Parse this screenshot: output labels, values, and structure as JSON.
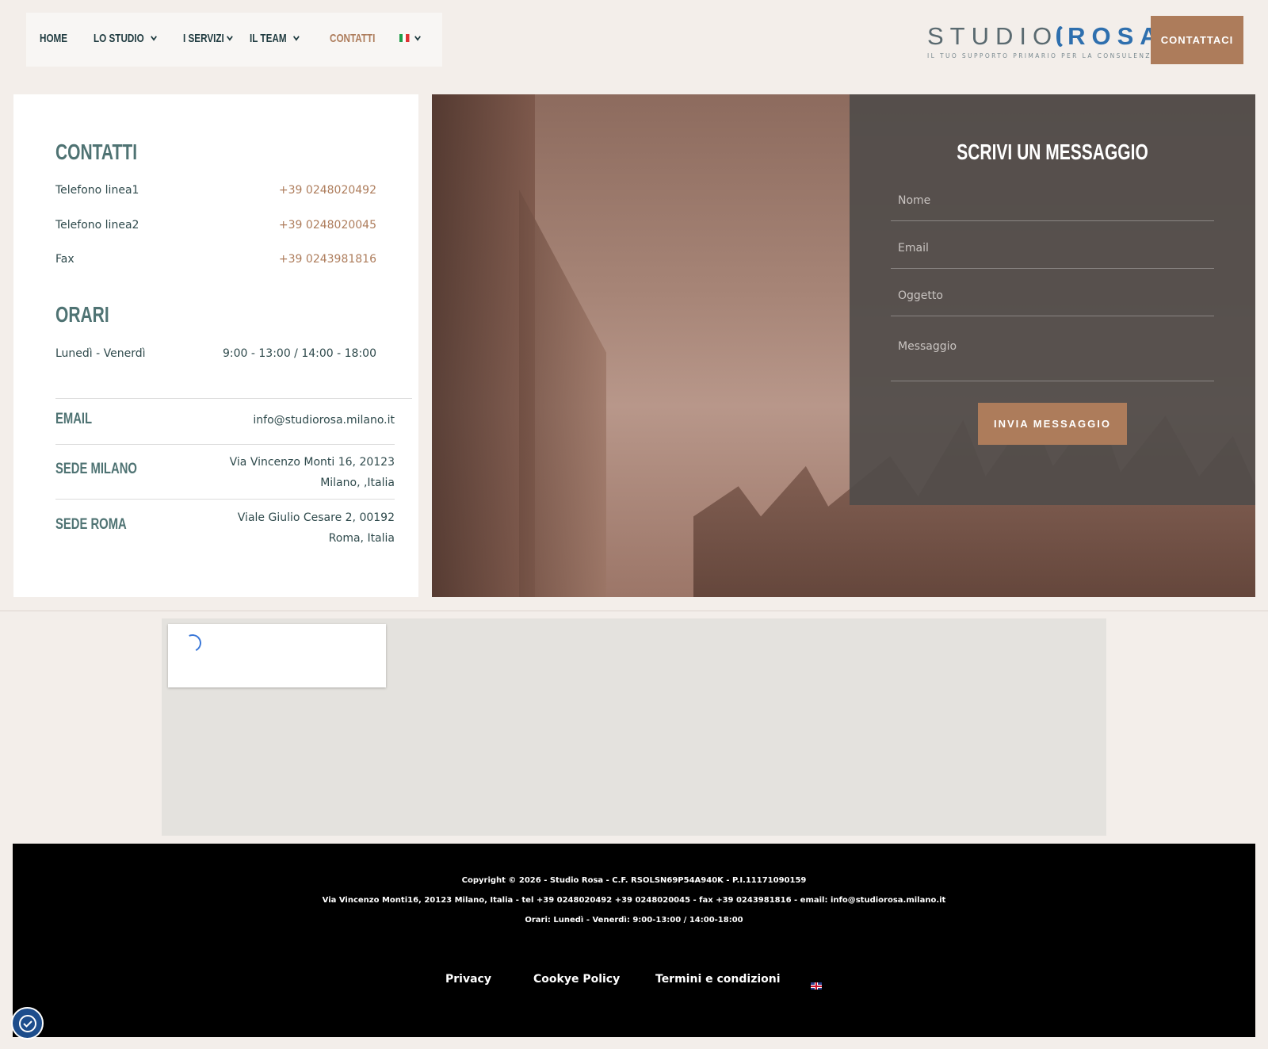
{
  "nav": {
    "items": [
      {
        "label": "HOME",
        "dropdown": false,
        "active": false
      },
      {
        "label": "LO STUDIO",
        "dropdown": true,
        "active": false
      },
      {
        "label": "I SERVIZI",
        "dropdown": true,
        "active": false
      },
      {
        "label": "IL TEAM",
        "dropdown": true,
        "active": false
      },
      {
        "label": "CONTATTI",
        "dropdown": false,
        "active": true
      }
    ],
    "language_flag": "flag-it-icon"
  },
  "logo": {
    "word1": "STUDIO",
    "word2": "ROSA",
    "tagline": "IL TUO SUPPORTO PRIMARIO PER LA CONSULENZA"
  },
  "header_button": "CONTATTACI",
  "contacts": {
    "title": "CONTATTI",
    "rows": [
      {
        "label": "Telefono linea1",
        "value": "+39 0248020492"
      },
      {
        "label": "Telefono linea2",
        "value": "+39 0248020045"
      },
      {
        "label": "Fax",
        "value": "+39 0243981816"
      }
    ]
  },
  "hours": {
    "title": "ORARI",
    "label": "Lunedì - Venerdì",
    "value": "9:00 - 13:00 / 14:00 - 18:00"
  },
  "info": [
    {
      "label": "EMAIL",
      "line1": "info@studiorosa.milano.it",
      "line2": ""
    },
    {
      "label": "SEDE MILANO",
      "line1": "Via Vincenzo Monti 16, 20123",
      "line2": "Milano, ,Italia"
    },
    {
      "label": "SEDE ROMA",
      "line1": "Viale Giulio Cesare 2, 00192",
      "line2": "Roma, Italia"
    }
  ],
  "form": {
    "title": "SCRIVI UN MESSAGGIO",
    "name_placeholder": "Nome",
    "email_placeholder": "Email",
    "subject_placeholder": "Oggetto",
    "message_placeholder": "Messaggio",
    "submit": "INVIA MESSAGGIO"
  },
  "footer": {
    "copyright": "Copyright © 2026 - Studio Rosa - C.F. RSOLSN69P54A940K - P.I.11171090159",
    "address": "Via Vincenzo Monti16, 20123 Milano, Italia - tel +39 0248020492 +39 0248020045 - fax +39 0243981816 - email: info@studiorosa.milano.it",
    "hours": "Orari: Lunedì - Venerdì: 9:00-13:00 / 14:00-18:00",
    "links": [
      "Privacy",
      "Cookye Policy",
      "Termini e condizioni"
    ],
    "language_flag": "flag-uk-icon"
  },
  "colors": {
    "accent": "#ad7c5b",
    "heading": "#4f7373",
    "brand_blue": "#2e6fae",
    "background": "#f3eeea"
  }
}
